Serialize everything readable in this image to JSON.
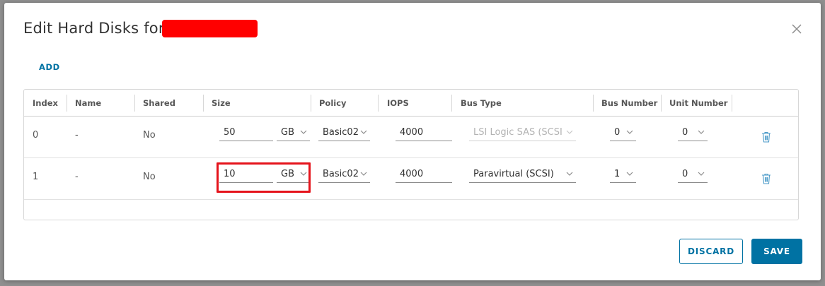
{
  "dialog": {
    "title": "Edit Hard Disks for",
    "close_icon": "close-icon",
    "add_label": "ADD",
    "discard_label": "DISCARD",
    "save_label": "SAVE"
  },
  "table": {
    "columns": [
      "Index",
      "Name",
      "Shared",
      "Size",
      "Policy",
      "IOPS",
      "Bus Type",
      "Bus Number",
      "Unit Number"
    ],
    "rows": [
      {
        "index": "0",
        "name": "-",
        "shared": "No",
        "size": "50",
        "size_unit": "GB",
        "policy": "Basic02",
        "iops": "4000",
        "bus_type": "LSI Logic SAS (SCSI)",
        "bus_type_disabled": true,
        "bus_number": "0",
        "unit_number": "0"
      },
      {
        "index": "1",
        "name": "-",
        "shared": "No",
        "size": "10",
        "size_unit": "GB",
        "policy": "Basic02",
        "iops": "4000",
        "bus_type": "Paravirtual (SCSI)",
        "bus_type_disabled": false,
        "bus_number": "1",
        "unit_number": "0"
      }
    ]
  },
  "colors": {
    "accent": "#0072a3",
    "highlight": "#e5131b",
    "redaction": "#ff0000"
  }
}
